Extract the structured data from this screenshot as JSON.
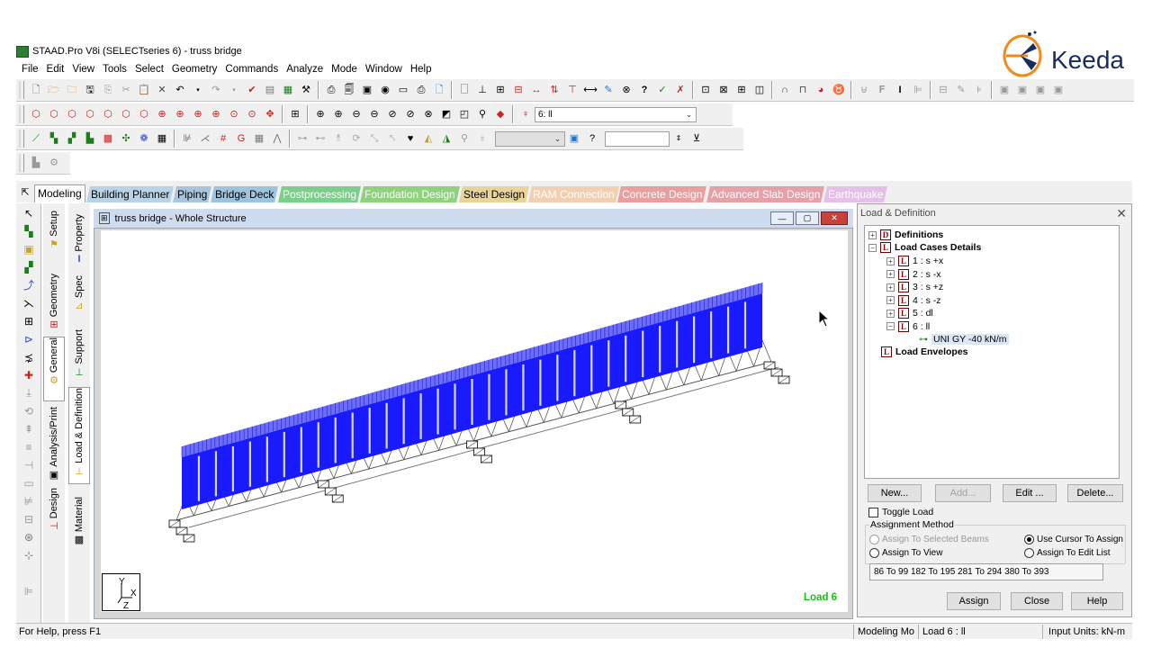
{
  "window": {
    "title": "STAAD.Pro V8i (SELECTseries 6) - truss bridge"
  },
  "menu": [
    "File",
    "Edit",
    "View",
    "Tools",
    "Select",
    "Geometry",
    "Commands",
    "Analyze",
    "Mode",
    "Window",
    "Help"
  ],
  "toolbar": {
    "load_combo_value": "6: ll",
    "empty_combo_value": "",
    "spin_value": ""
  },
  "logo": {
    "text": "Keeda"
  },
  "page_tabs": [
    {
      "label": "Modeling",
      "color": "#f0f0f0"
    },
    {
      "label": "Building Planner",
      "color": "#b8d3e6"
    },
    {
      "label": "Piping",
      "color": "#a7c6dd"
    },
    {
      "label": "Bridge Deck",
      "color": "#9cc4dc"
    },
    {
      "label": "Postprocessing",
      "color": "#7ccf8a"
    },
    {
      "label": "Foundation Design",
      "color": "#8fd27d"
    },
    {
      "label": "Steel Design",
      "color": "#e8d49a"
    },
    {
      "label": "RAM Connection",
      "color": "#f3cfb1"
    },
    {
      "label": "Concrete Design",
      "color": "#ea9e9e"
    },
    {
      "label": "Advanced Slab Design",
      "color": "#e5a0a8"
    },
    {
      "label": "Earthquake",
      "color": "#e4bfe7"
    }
  ],
  "side_tabs_outer": [
    {
      "label": "Setup"
    },
    {
      "label": "Geometry"
    },
    {
      "label": "General"
    },
    {
      "label": "Analysis/Print"
    },
    {
      "label": "Design"
    }
  ],
  "side_tabs_inner": [
    {
      "label": "Property"
    },
    {
      "label": "Spec"
    },
    {
      "label": "Support"
    },
    {
      "label": "Load & Definition"
    },
    {
      "label": "Material"
    }
  ],
  "viewport": {
    "title": "truss bridge - Whole Structure",
    "load_label": "Load 6",
    "axis_y": "Y",
    "axis_x": "X",
    "axis_z": "Z",
    "load_color": "#1a1aff"
  },
  "panel": {
    "title": "Load & Definition",
    "tree": {
      "definitions": "Definitions",
      "load_cases": "Load Cases Details",
      "cases": [
        "1 : s +x",
        "2 : s -x",
        "3 : s +z",
        "4 : s -z",
        "5 : dl",
        "6 : ll"
      ],
      "load_item": "UNI GY -40 kN/m",
      "envelopes": "Load Envelopes"
    },
    "buttons": {
      "new": "New...",
      "add": "Add...",
      "edit": "Edit ...",
      "delete": "Delete..."
    },
    "toggle_load": "Toggle Load",
    "assignment_method": "Assignment Method",
    "radio": {
      "selected_beams": "Assign To Selected Beams",
      "cursor": "Use Cursor To Assign",
      "view": "Assign To View",
      "edit_list": "Assign To Edit List"
    },
    "edit_list_value": "86 To 99 182 To 195 281 To 294 380 To 393",
    "assign": "Assign",
    "close": "Close",
    "help": "Help"
  },
  "status": {
    "help": "For Help, press F1",
    "mode": "Modeling Mo",
    "load": "Load 6 : ll",
    "units": "Input Units:  kN-m"
  }
}
